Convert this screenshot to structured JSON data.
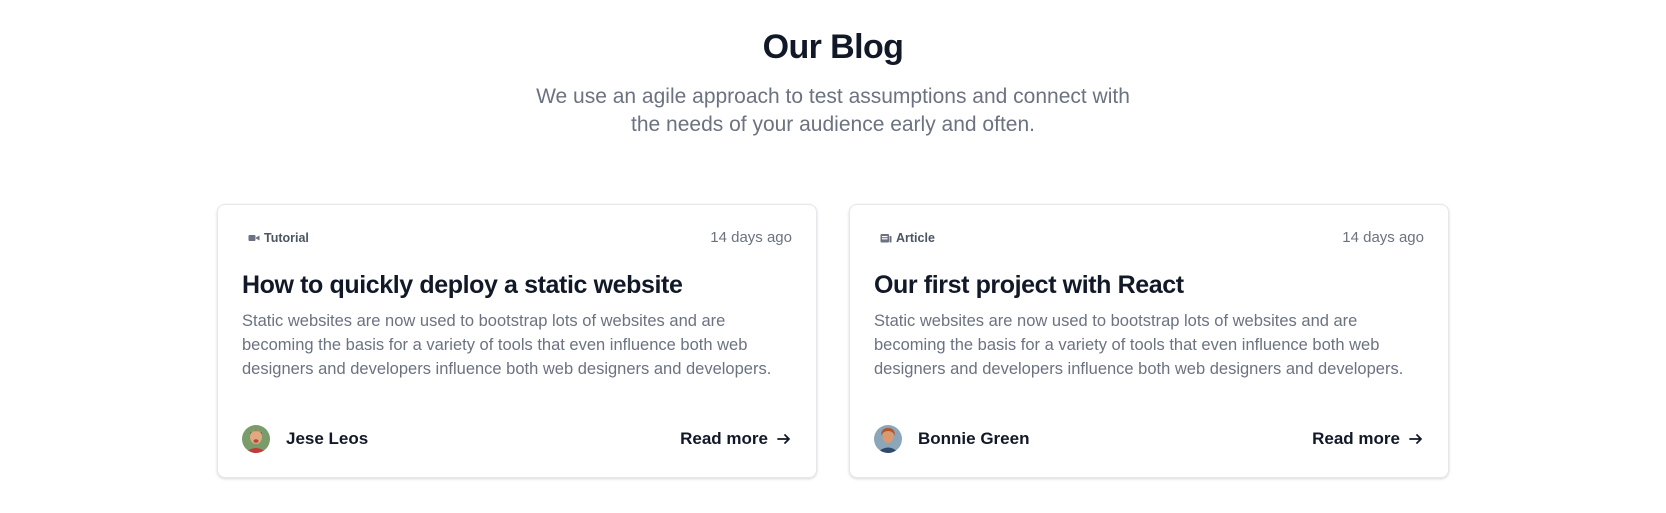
{
  "section": {
    "title": "Our Blog",
    "subtitle_line1": "We use an agile approach to test assumptions and connect with",
    "subtitle_line2": "the needs of your audience early and often."
  },
  "posts": [
    {
      "badge": {
        "label": "Tutorial",
        "icon": "video-icon"
      },
      "date": "14 days ago",
      "title": "How to quickly deploy a static website",
      "excerpt": "Static websites are now used to bootstrap lots of websites and are becoming the basis for a variety of tools that even influence both web designers and developers influence both web designers and developers.",
      "author": {
        "name": "Jese Leos",
        "avatar": "avatar-jese-leos"
      },
      "link_label": "Read more"
    },
    {
      "badge": {
        "label": "Article",
        "icon": "newspaper-icon"
      },
      "date": "14 days ago",
      "title": "Our first project with React",
      "excerpt": "Static websites are now used to bootstrap lots of websites and are becoming the basis for a variety of tools that even influence both web designers and developers influence both web designers and developers.",
      "author": {
        "name": "Bonnie Green",
        "avatar": "avatar-bonnie-green"
      },
      "link_label": "Read more"
    }
  ],
  "colors": {
    "heading": "#111827",
    "muted_text": "#6b7280",
    "card_border": "#e5e7eb"
  }
}
